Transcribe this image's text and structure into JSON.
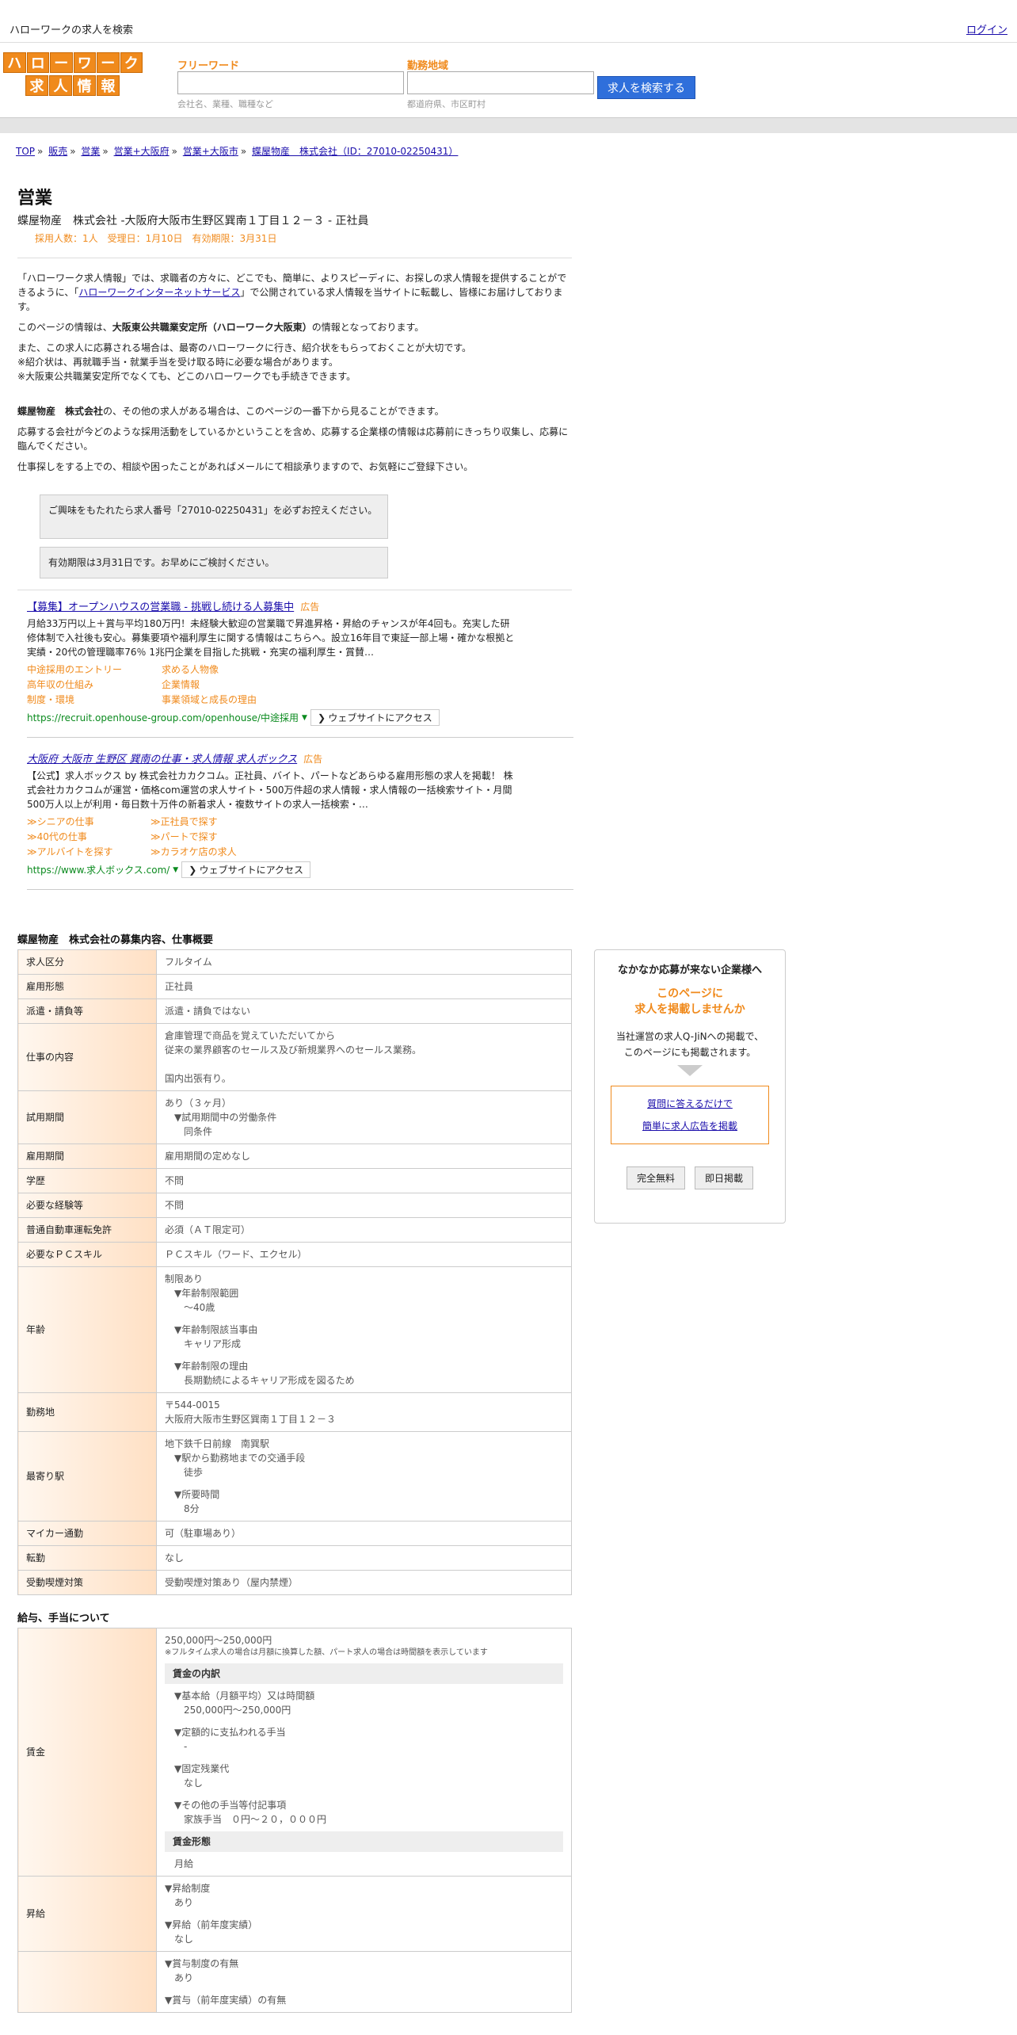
{
  "topbar": {
    "tagline": "ハローワークの求人を検索",
    "login": "ログイン"
  },
  "logo": {
    "row1": [
      "ハ",
      "ロ",
      "ー",
      "ワ",
      "ー",
      "ク"
    ],
    "row2": [
      "求",
      "人",
      "情",
      "報"
    ]
  },
  "search": {
    "keyword_label": "フリーワード",
    "keyword_hint": "会社名、業種、職種など",
    "area_label": "勤務地域",
    "area_hint": "都道府県、市区町村",
    "button": "求人を検索する"
  },
  "breadcrumb": [
    "TOP",
    "販売",
    "営業",
    "営業+大阪府",
    "営業+大阪市",
    "蝶屋物産　株式会社（ID：27010-02250431）"
  ],
  "job": {
    "title": "営業",
    "subtitle": "蝶屋物産　株式会社 -大阪府大阪市生野区巽南１丁目１２－３ - 正社員",
    "meta": "採用人数：1人　受理日：1月10日　有効期限：3月31日"
  },
  "intro": {
    "p1_a": "「ハローワーク求人情報」では、求職者の方々に、どこでも、簡単に、よりスピーディに、お探しの求人情報を提供することができるように、「",
    "p1_link": "ハローワークインターネットサービス",
    "p1_b": "」で公開されている求人情報を当サイトに転載し、皆様にお届けしております。",
    "p2_a": "このページの情報は、",
    "p2_b": "大阪東公共職業安定所（ハローワーク大阪東）",
    "p2_c": "の情報となっております。",
    "p3": "また、この求人に応募される場合は、最寄のハローワークに行き、紹介状をもらっておくことが大切です。",
    "p3b": "※紹介状は、再就職手当・就業手当を受け取る時に必要な場合があります。",
    "p3c": "※大阪東公共職業安定所でなくても、どこのハローワークでも手続きできます。",
    "p4_a": "蝶屋物産　株式会社",
    "p4_b": "の、その他の求人がある場合は、このページの一番下から見ることができます。",
    "p5": "応募する会社が今どのような採用活動をしているかということを含め、応募する企業様の情報は応募前にきっちり収集し、応募に臨んでください。",
    "p6": "仕事探しをする上での、相談や困ったことがあればメールにて相談承りますので、お気軽にご登録下さい。"
  },
  "notices": [
    "ご興味をもたれたら求人番号「27010-02250431」を必ずお控えください。",
    "有効期限は3月31日です。お早めにご検討ください。"
  ],
  "ads": [
    {
      "title": "【募集】オープンハウスの営業職 - 挑戦し続ける人募集中",
      "tag": "広告",
      "body": "月給33万円以上＋賞与平均180万円！未経験大歓迎の営業職で昇進昇格・昇給のチャンスが年4回も。充実した研修体制で入社後も安心。募集要項や福利厚生に関する情報はこちらへ。設立16年目で東証一部上場・確かな根拠と実績・20代の管理職率76％ 1兆円企業を目指した挑戦・充実の福利厚生・賞賛…",
      "links": [
        "中途採用のエントリー",
        "求める人物像",
        "高年収の仕組み",
        "企業情報",
        "制度・環境",
        "事業領域と成長の理由"
      ],
      "url": "https://recruit.openhouse-group.com/openhouse/中途採用",
      "visit": "ウェブサイトにアクセス"
    },
    {
      "title": "大阪府 大阪市 生野区 巽南の仕事・求人情報 求人ボックス",
      "tag": "広告",
      "body": "【公式】求人ボックス by 株式会社カカクコム。正社員、バイト、パートなどあらゆる雇用形態の求人を掲載！ 株式会社カカクコムが運営・価格com運営の求人サイト・500万件超の求人情報・求人情報の一括検索サイト・月間500万人以上が利用・毎日数十万件の新着求人・複数サイトの求人一括検索・…",
      "links": [
        "≫シニアの仕事",
        "≫正社員で探す",
        "≫40代の仕事",
        "≫パートで探す",
        "≫アルバイトを探す",
        "≫カラオケ店の求人"
      ],
      "url": "https://www.求人ボックス.com/",
      "visit": "ウェブサイトにアクセス"
    }
  ],
  "spec": {
    "title": "蝶屋物産　株式会社の募集内容、仕事概要",
    "rows": {
      "kubun": [
        "求人区分",
        "フルタイム"
      ],
      "koyou": [
        "雇用形態",
        "正社員"
      ],
      "haken": [
        "派遣・請負等",
        "派遣・請負ではない"
      ],
      "naiyou_k": "仕事の内容",
      "naiyou_1": "倉庫管理で商品を覚えていただいてから",
      "naiyou_2": "従来の業界顧客のセールス及び新規業界へのセールス業務。",
      "naiyou_3": "国内出張有り。",
      "shiyou_k": "試用期間",
      "shiyou_1": "あり（３ヶ月）",
      "shiyou_2": "▼試用期間中の労働条件",
      "shiyou_3": "同条件",
      "kikan": [
        "雇用期間",
        "雇用期間の定めなし"
      ],
      "gakureki": [
        "学歴",
        "不問"
      ],
      "keiken": [
        "必要な経験等",
        "不問"
      ],
      "menkyo": [
        "普通自動車運転免許",
        "必須（ＡＴ限定可）"
      ],
      "skill": [
        "必要なＰＣスキル",
        "ＰＣスキル（ワード、エクセル）"
      ],
      "nenrei_k": "年齢",
      "nenrei_1": "制限あり",
      "nenrei_2": "▼年齢制限範囲",
      "nenrei_3": "〜40歳",
      "nenrei_4": "▼年齢制限該当事由",
      "nenrei_5": "キャリア形成",
      "nenrei_6": "▼年齢制限の理由",
      "nenrei_7": "長期勤続によるキャリア形成を図るため",
      "kinmu_k": "勤務地",
      "kinmu_1": "〒544-0015",
      "kinmu_2": "大阪府大阪市生野区巽南１丁目１２－３",
      "eki_k": "最寄り駅",
      "eki_1": "地下鉄千日前線　南巽駅",
      "eki_2": "▼駅から勤務地までの交通手段",
      "eki_3": "徒歩",
      "eki_4": "▼所要時間",
      "eki_5": "8分",
      "mycar": [
        "マイカー通勤",
        "可（駐車場あり）"
      ],
      "tenkin": [
        "転勤",
        "なし"
      ],
      "kitsuen": [
        "受動喫煙対策",
        "受動喫煙対策あり（屋内禁煙）"
      ]
    }
  },
  "salary": {
    "title": "給与、手当について",
    "chingin_k": "賃金",
    "range": "250,000円〜250,000円",
    "note": "※フルタイム求人の場合は月額に換算した額、パート求人の場合は時間額を表示しています",
    "uchiwake": "賃金の内訳",
    "kihon": "▼基本給（月額平均）又は時間額",
    "kihon_v": "250,000円〜250,000円",
    "teigaku": "▼定額的に支払われる手当",
    "teigaku_v": "-",
    "kotei": "▼固定残業代",
    "kotei_v": "なし",
    "sonota": "▼その他の手当等付記事項",
    "sonota_v": "家族手当　０円〜２０，０００円",
    "keitai": "賃金形態",
    "keitai_v": "月給",
    "shokyu_k": "昇給",
    "shokyu_1": "▼昇給制度",
    "shokyu_2": "あり",
    "shokyu_3": "▼昇給（前年度実績）",
    "shokyu_4": "なし",
    "shoyo_1": "▼賞与制度の有無",
    "shoyo_2": "あり",
    "shoyo_3": "▼賞与（前年度実績）の有無"
  },
  "side": {
    "heading": "なかなか応募が来ない企業様へ",
    "orange1": "このページに",
    "orange2": "求人を掲載しませんか",
    "desc1": "当社運営の求人Q-JiNへの掲載で、",
    "desc2": "このページにも掲載されます。",
    "link1": "質問に答えるだけで",
    "link2": "簡単に求人広告を掲載",
    "btn1": "完全無料",
    "btn2": "即日掲載"
  },
  "colors": {
    "accent": "#f08a1c",
    "link": "#1a0dab",
    "button": "#2f6fdb",
    "url": "#0a8a1e"
  }
}
